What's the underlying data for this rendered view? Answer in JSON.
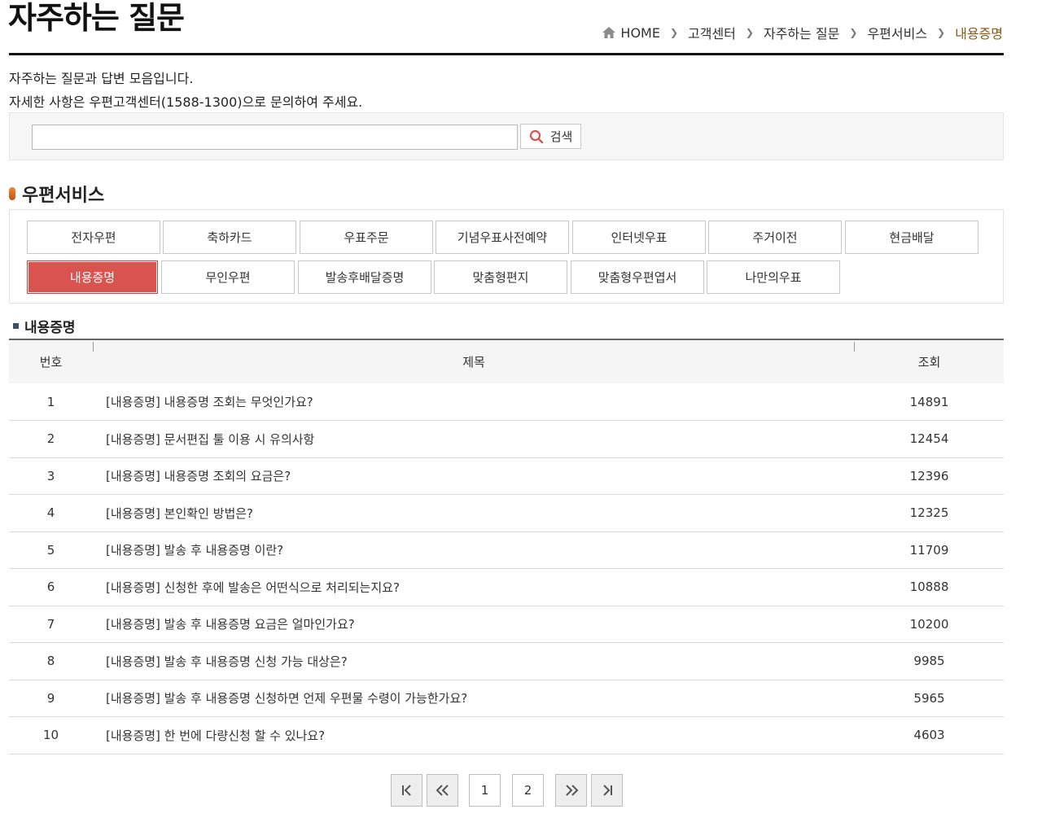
{
  "header": {
    "title": "자주하는 질문",
    "breadcrumb": [
      "HOME",
      "고객센터",
      "자주하는 질문",
      "우편서비스",
      "내용증명"
    ]
  },
  "intro": {
    "line1": "자주하는 질문과 답변 모음입니다.",
    "line2": "자세한 사항은 우편고객센터(1588-1300)으로 문의하여 주세요."
  },
  "search": {
    "value": "",
    "placeholder": "",
    "button_label": "검색"
  },
  "section": {
    "title": "우편서비스",
    "categories_row1": [
      "전자우편",
      "축하카드",
      "우표주문",
      "기념우표사전예약",
      "인터넷우표",
      "주거이전",
      "현금배달"
    ],
    "categories_row2": [
      "내용증명",
      "무인우편",
      "발송후배달증명",
      "맞춤형편지",
      "맞춤형우편엽서",
      "나만의우표"
    ],
    "active_category": "내용증명"
  },
  "list": {
    "title": "내용증명",
    "headers": {
      "no": "번호",
      "title": "제목",
      "views": "조회"
    },
    "rows": [
      {
        "no": "1",
        "title": "[내용증명] 내용증명 조회는 무엇인가요?",
        "views": "14891"
      },
      {
        "no": "2",
        "title": "[내용증명] 문서편집 툴 이용 시 유의사항",
        "views": "12454"
      },
      {
        "no": "3",
        "title": "[내용증명] 내용증명 조회의 요금은?",
        "views": "12396"
      },
      {
        "no": "4",
        "title": "[내용증명] 본인확인 방법은?",
        "views": "12325"
      },
      {
        "no": "5",
        "title": "[내용증명] 발송 후 내용증명 이란?",
        "views": "11709"
      },
      {
        "no": "6",
        "title": "[내용증명] 신청한 후에 발송은 어떤식으로 처리되는지요?",
        "views": "10888"
      },
      {
        "no": "7",
        "title": "[내용증명] 발송 후 내용증명 요금은 얼마인가요?",
        "views": "10200"
      },
      {
        "no": "8",
        "title": "[내용증명] 발송 후 내용증명 신청 가능 대상은?",
        "views": "9985"
      },
      {
        "no": "9",
        "title": "[내용증명] 발송 후 내용증명 신청하면 언제 우편물 수령이 가능한가요?",
        "views": "5965"
      },
      {
        "no": "10",
        "title": "[내용증명] 한 번에 다량신청 할 수 있나요?",
        "views": "4603"
      }
    ]
  },
  "pagination": {
    "pages": [
      "1",
      "2"
    ],
    "first_icon": "first-page-icon",
    "prev_icon": "double-chevron-left-icon",
    "next_icon": "double-chevron-right-icon",
    "last_icon": "last-page-icon"
  },
  "colors": {
    "active_category": "#d9534f",
    "breadcrumb_current": "#8a5a12",
    "section_marker": "#e06a20"
  }
}
